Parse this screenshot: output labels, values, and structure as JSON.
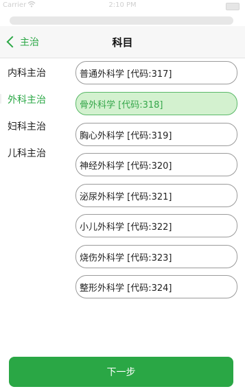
{
  "status_bar": {
    "carrier": "Carrier",
    "time": "2:10 PM"
  },
  "nav": {
    "back_label": "主治",
    "title": "科目"
  },
  "categories": [
    {
      "label": "内科主治",
      "active": false
    },
    {
      "label": "外科主治",
      "active": true
    },
    {
      "label": "妇科主治",
      "active": false
    },
    {
      "label": "儿科主治",
      "active": false
    }
  ],
  "options": [
    {
      "label": "普通外科学 [代码:317]",
      "selected": false
    },
    {
      "label": "骨外科学 [代码:318]",
      "selected": true
    },
    {
      "label": "胸心外科学 [代码:319]",
      "selected": false
    },
    {
      "label": "神经外科学 [代码:320]",
      "selected": false
    },
    {
      "label": "泌尿外科学 [代码:321]",
      "selected": false
    },
    {
      "label": "小儿外科学 [代码:322]",
      "selected": false
    },
    {
      "label": "烧伤外科学 [代码:323]",
      "selected": false
    },
    {
      "label": "整形外科学 [代码:324]",
      "selected": false
    }
  ],
  "next_button": {
    "label": "下一步"
  },
  "colors": {
    "accent": "#2aa745",
    "selected_bg": "#d3f1cf",
    "selected_text": "#35a64a"
  }
}
